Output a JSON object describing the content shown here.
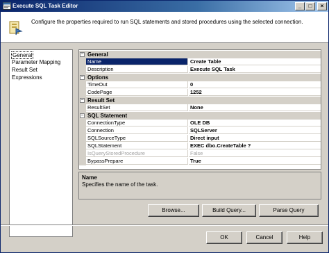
{
  "window": {
    "title": "Execute SQL Task Editor",
    "controls": {
      "minimize": "_",
      "maximize": "□",
      "close": "×"
    }
  },
  "header": {
    "description": "Configure the properties required to run SQL statements and stored procedures using the selected connection.",
    "icon": "task-wizard-icon"
  },
  "nav": {
    "items": [
      {
        "label": "General",
        "selected": true
      },
      {
        "label": "Parameter Mapping",
        "selected": false
      },
      {
        "label": "Result Set",
        "selected": false
      },
      {
        "label": "Expressions",
        "selected": false
      }
    ]
  },
  "grid": {
    "categories": [
      {
        "name": "General",
        "expander": "⊟",
        "props": [
          {
            "name": "Name",
            "value": "Create Table"
          },
          {
            "name": "Description",
            "value": "Execute SQL Task"
          }
        ]
      },
      {
        "name": "Options",
        "expander": "⊟",
        "props": [
          {
            "name": "TimeOut",
            "value": "0"
          },
          {
            "name": "CodePage",
            "value": "1252"
          }
        ]
      },
      {
        "name": "Result Set",
        "expander": "⊟",
        "props": [
          {
            "name": "ResultSet",
            "value": "None"
          }
        ]
      },
      {
        "name": "SQL Statement",
        "expander": "⊟",
        "props": [
          {
            "name": "ConnectionType",
            "value": "OLE DB"
          },
          {
            "name": "Connection",
            "value": "SQLServer"
          },
          {
            "name": "SQLSourceType",
            "value": "Direct input"
          },
          {
            "name": "SQLStatement",
            "value": "EXEC dbo.CreateTable ?"
          },
          {
            "name": "IsQueryStoredProcedure",
            "value": "False"
          },
          {
            "name": "BypassPrepare",
            "value": "True"
          }
        ]
      }
    ]
  },
  "description": {
    "title": "Name",
    "text": "Specifies the name of the task."
  },
  "buttons": {
    "browse": "Browse...",
    "build_query": "Build Query...",
    "parse_query": "Parse Query",
    "ok": "OK",
    "cancel": "Cancel",
    "help": "Help"
  },
  "colors": {
    "title_start": "#0a246a",
    "title_end": "#a6caf0",
    "selection": "#0a246a",
    "face": "#d4d0c8"
  }
}
